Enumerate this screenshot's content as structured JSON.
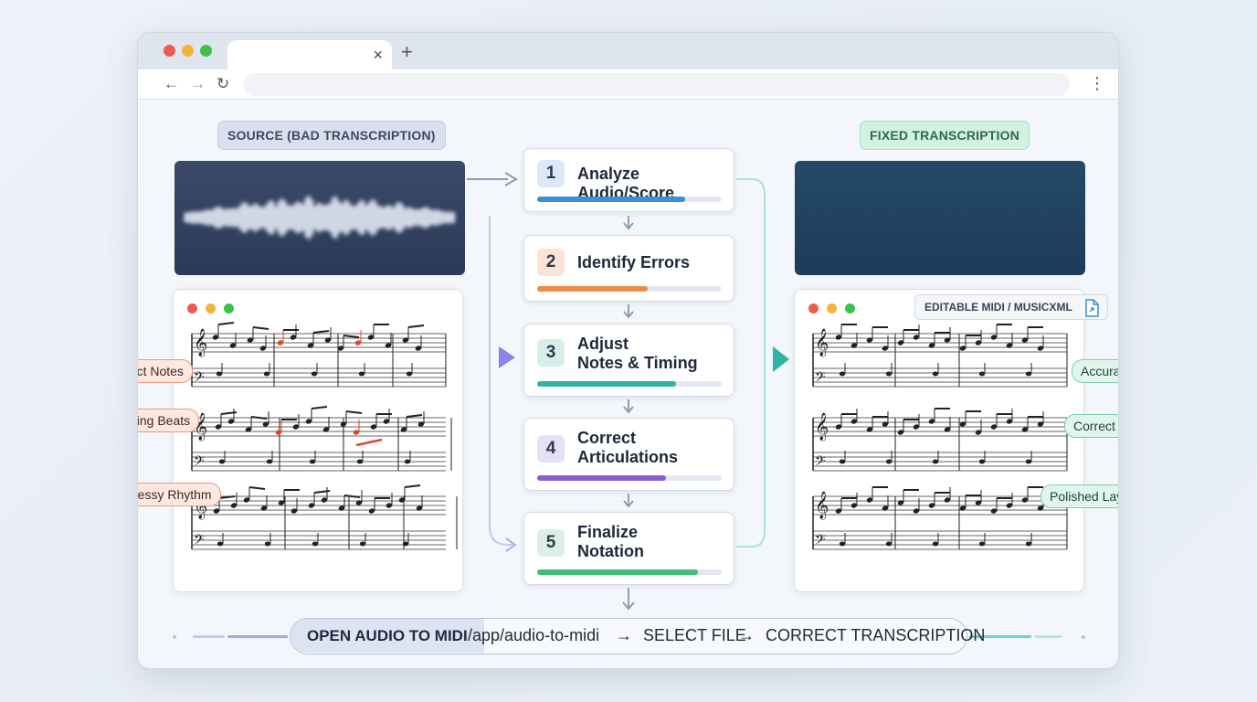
{
  "browser": {
    "tab_close": "×",
    "new_tab": "+",
    "nav": {
      "back": "←",
      "forward": "→",
      "reload": "↻",
      "menu": "⋮"
    },
    "url": ""
  },
  "left": {
    "heading": "SOURCE (BAD TRANSCRIPTION)",
    "callouts": [
      "Incorrect Notes",
      "Missing Beats",
      "Messy Rhythm"
    ]
  },
  "right": {
    "heading": "FIXED TRANSCRIPTION",
    "editable_label": "EDITABLE MIDI / MUSICXML",
    "callouts": [
      "Accurate Notes",
      "Correct Timing",
      "Polished Layout"
    ]
  },
  "steps": [
    {
      "num": "1",
      "label": "Analyze Audio/Score",
      "progress": 0.8,
      "color": "#3e8fd6",
      "badge": "#dde8f6"
    },
    {
      "num": "2",
      "label": "Identify Errors",
      "progress": 0.6,
      "color": "#ef8a45",
      "badge": "#fbe3d6"
    },
    {
      "num": "3",
      "label": "Adjust\nNotes & Timing",
      "progress": 0.75,
      "color": "#2fb3a5",
      "badge": "#d7efec"
    },
    {
      "num": "4",
      "label": "Correct\nArticulations",
      "progress": 0.7,
      "color": "#8a5cd8",
      "badge": "#e6e0f6"
    },
    {
      "num": "5",
      "label": "Finalize\nNotation",
      "progress": 0.87,
      "color": "#3fbf7a",
      "badge": "#dcefe4"
    }
  ],
  "command": {
    "head": "OPEN AUDIO TO MIDI",
    "path": "/app/audio-to-midi",
    "arrow": "→",
    "action1": "SELECT FILE",
    "action2": "CORRECT TRANSCRIPTION"
  },
  "colors": {
    "accent_blue": "#3e8fd6",
    "accent_orange": "#ef8a45",
    "accent_teal": "#2fb3a5",
    "accent_purple": "#8a5cd8",
    "accent_green": "#3fbf7a",
    "error_red": "#e0462c"
  }
}
